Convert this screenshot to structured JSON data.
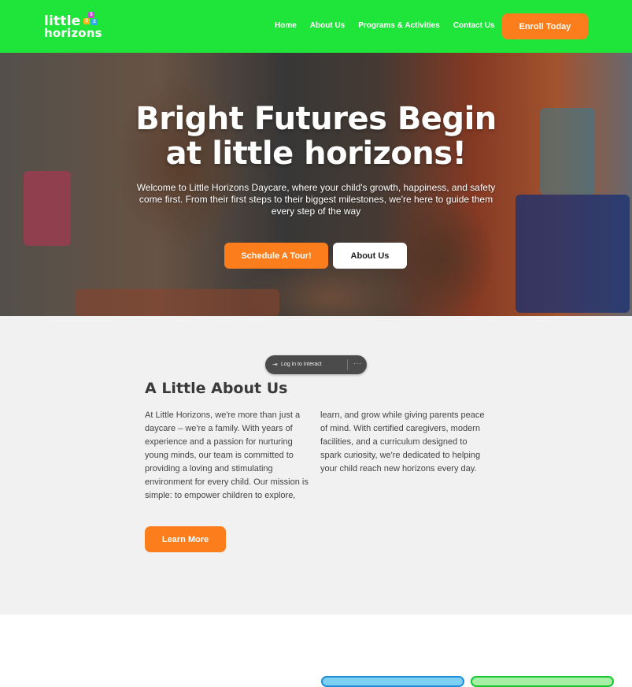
{
  "brand": {
    "logo_line1": "little",
    "logo_line2": "horizons",
    "logo_blocks": [
      "5",
      "3",
      "2"
    ]
  },
  "nav": {
    "items": [
      "Home",
      "About Us",
      "Programs & Activities",
      "Contact Us"
    ],
    "cta_label": "Enroll Today"
  },
  "hero": {
    "title_line1": "Bright Futures Begin",
    "title_line2": "at little horizons!",
    "subtitle": "Welcome to Little Horizons Daycare, where your child's growth, happiness, and safety come first. From their first steps to their biggest milestones, we're here to guide them every step of the way",
    "primary_button": "Schedule A Tour!",
    "secondary_button": "About Us"
  },
  "overlay": {
    "login_label": "Log in to interact",
    "more_label": "···"
  },
  "about": {
    "title": "A Little About Us",
    "col1": "At Little Horizons, we're more than just a daycare – we're a family. With years of experience and a passion for nurturing young minds, our team is committed to providing a loving and stimulating environment for every child. Our mission is simple: to empower children to explore,",
    "col2": "learn, and grow while giving parents peace of mind. With certified caregivers, modern facilities, and a curriculum designed to spark curiosity, we're dedicated to helping your child reach new horizons every day.",
    "button": "Learn More"
  },
  "colors": {
    "header_green": "#1fe53a",
    "accent_orange": "#fb7d1b",
    "section_gray": "#f1f1f1"
  }
}
